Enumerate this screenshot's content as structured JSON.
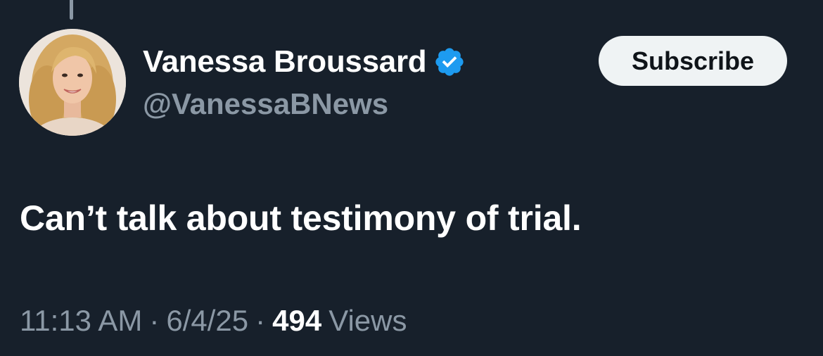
{
  "author": {
    "display_name": "Vanessa Broussard",
    "handle": "@VanessaBNews",
    "verified": true,
    "verified_icon": "verified-badge-icon",
    "avatar_icon": "profile-avatar"
  },
  "actions": {
    "subscribe_label": "Subscribe"
  },
  "tweet": {
    "text": "Can’t talk about testimony of trial."
  },
  "meta": {
    "time": "11:13 AM",
    "date": "6/4/25",
    "separator": "·",
    "views_count": "494",
    "views_label": "Views"
  },
  "colors": {
    "background": "#17202b",
    "primary_text": "#ffffff",
    "secondary_text": "#8b98a5",
    "verified_blue": "#1d9bf0",
    "button_bg": "#eff3f4"
  }
}
